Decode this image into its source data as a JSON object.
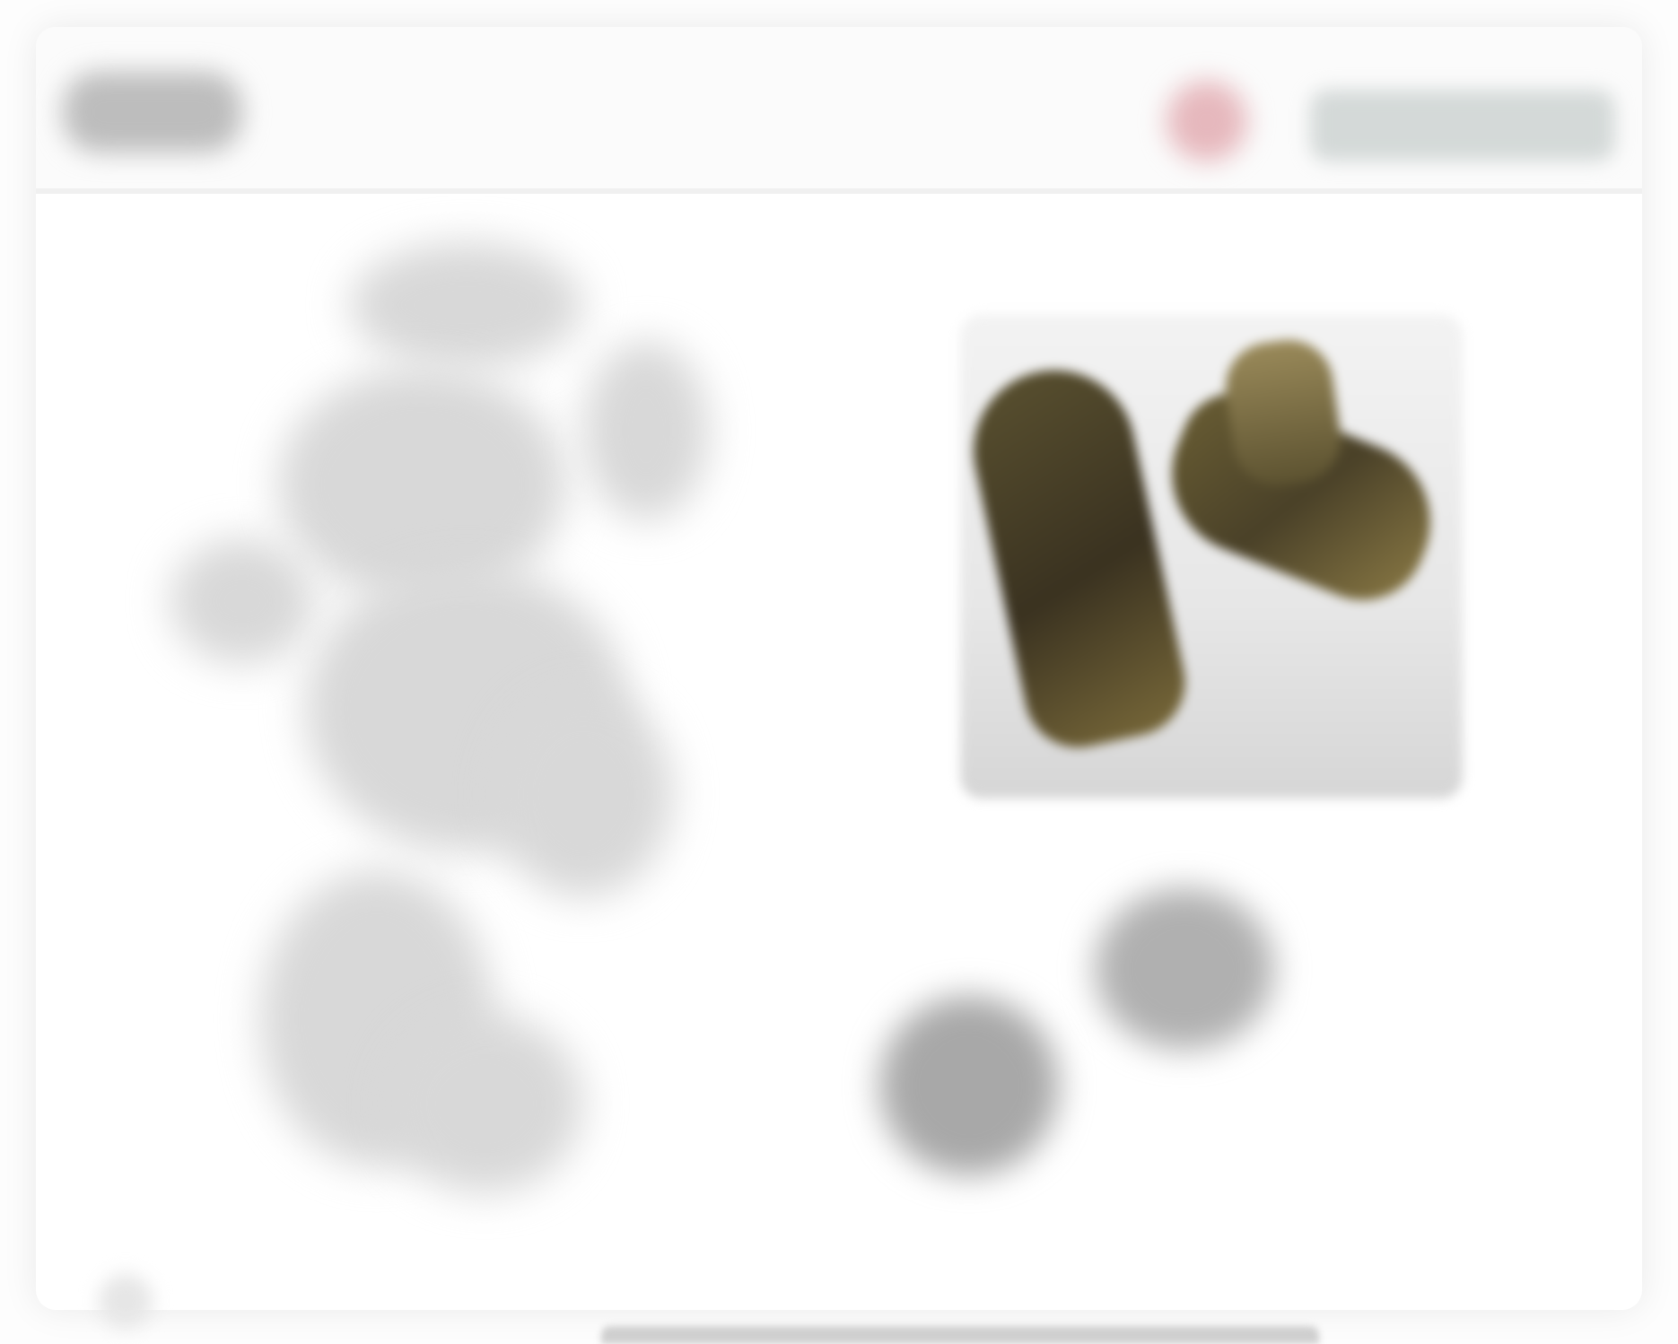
{
  "toolbar": {
    "logo_icon": "logo-icon",
    "status_icon": "status-dot-icon",
    "action_label": ""
  },
  "canvas": {
    "sketch_label": "",
    "photo_alt": ""
  },
  "colors": {
    "status": "#e6b8bd",
    "action_bar": "#d4d9d8",
    "boot_dark": "#3a3220",
    "boot_light": "#8b7a45"
  }
}
